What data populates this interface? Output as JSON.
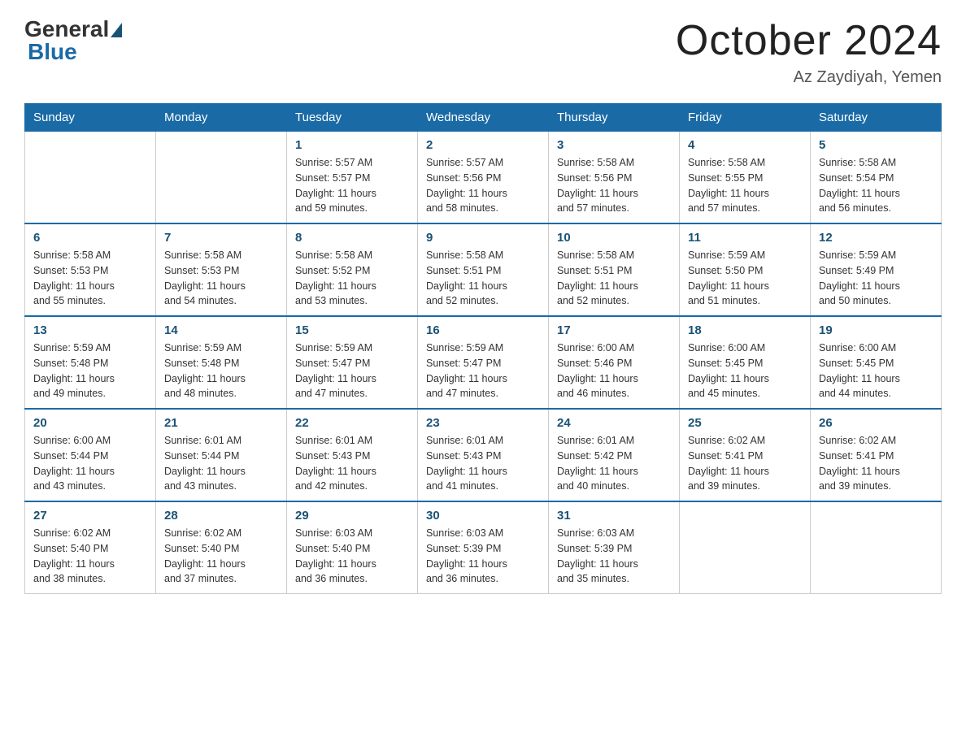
{
  "logo": {
    "general": "General",
    "blue": "Blue"
  },
  "title": "October 2024",
  "subtitle": "Az Zaydiyah, Yemen",
  "headers": [
    "Sunday",
    "Monday",
    "Tuesday",
    "Wednesday",
    "Thursday",
    "Friday",
    "Saturday"
  ],
  "weeks": [
    [
      {
        "day": "",
        "info": ""
      },
      {
        "day": "",
        "info": ""
      },
      {
        "day": "1",
        "info": "Sunrise: 5:57 AM\nSunset: 5:57 PM\nDaylight: 11 hours\nand 59 minutes."
      },
      {
        "day": "2",
        "info": "Sunrise: 5:57 AM\nSunset: 5:56 PM\nDaylight: 11 hours\nand 58 minutes."
      },
      {
        "day": "3",
        "info": "Sunrise: 5:58 AM\nSunset: 5:56 PM\nDaylight: 11 hours\nand 57 minutes."
      },
      {
        "day": "4",
        "info": "Sunrise: 5:58 AM\nSunset: 5:55 PM\nDaylight: 11 hours\nand 57 minutes."
      },
      {
        "day": "5",
        "info": "Sunrise: 5:58 AM\nSunset: 5:54 PM\nDaylight: 11 hours\nand 56 minutes."
      }
    ],
    [
      {
        "day": "6",
        "info": "Sunrise: 5:58 AM\nSunset: 5:53 PM\nDaylight: 11 hours\nand 55 minutes."
      },
      {
        "day": "7",
        "info": "Sunrise: 5:58 AM\nSunset: 5:53 PM\nDaylight: 11 hours\nand 54 minutes."
      },
      {
        "day": "8",
        "info": "Sunrise: 5:58 AM\nSunset: 5:52 PM\nDaylight: 11 hours\nand 53 minutes."
      },
      {
        "day": "9",
        "info": "Sunrise: 5:58 AM\nSunset: 5:51 PM\nDaylight: 11 hours\nand 52 minutes."
      },
      {
        "day": "10",
        "info": "Sunrise: 5:58 AM\nSunset: 5:51 PM\nDaylight: 11 hours\nand 52 minutes."
      },
      {
        "day": "11",
        "info": "Sunrise: 5:59 AM\nSunset: 5:50 PM\nDaylight: 11 hours\nand 51 minutes."
      },
      {
        "day": "12",
        "info": "Sunrise: 5:59 AM\nSunset: 5:49 PM\nDaylight: 11 hours\nand 50 minutes."
      }
    ],
    [
      {
        "day": "13",
        "info": "Sunrise: 5:59 AM\nSunset: 5:48 PM\nDaylight: 11 hours\nand 49 minutes."
      },
      {
        "day": "14",
        "info": "Sunrise: 5:59 AM\nSunset: 5:48 PM\nDaylight: 11 hours\nand 48 minutes."
      },
      {
        "day": "15",
        "info": "Sunrise: 5:59 AM\nSunset: 5:47 PM\nDaylight: 11 hours\nand 47 minutes."
      },
      {
        "day": "16",
        "info": "Sunrise: 5:59 AM\nSunset: 5:47 PM\nDaylight: 11 hours\nand 47 minutes."
      },
      {
        "day": "17",
        "info": "Sunrise: 6:00 AM\nSunset: 5:46 PM\nDaylight: 11 hours\nand 46 minutes."
      },
      {
        "day": "18",
        "info": "Sunrise: 6:00 AM\nSunset: 5:45 PM\nDaylight: 11 hours\nand 45 minutes."
      },
      {
        "day": "19",
        "info": "Sunrise: 6:00 AM\nSunset: 5:45 PM\nDaylight: 11 hours\nand 44 minutes."
      }
    ],
    [
      {
        "day": "20",
        "info": "Sunrise: 6:00 AM\nSunset: 5:44 PM\nDaylight: 11 hours\nand 43 minutes."
      },
      {
        "day": "21",
        "info": "Sunrise: 6:01 AM\nSunset: 5:44 PM\nDaylight: 11 hours\nand 43 minutes."
      },
      {
        "day": "22",
        "info": "Sunrise: 6:01 AM\nSunset: 5:43 PM\nDaylight: 11 hours\nand 42 minutes."
      },
      {
        "day": "23",
        "info": "Sunrise: 6:01 AM\nSunset: 5:43 PM\nDaylight: 11 hours\nand 41 minutes."
      },
      {
        "day": "24",
        "info": "Sunrise: 6:01 AM\nSunset: 5:42 PM\nDaylight: 11 hours\nand 40 minutes."
      },
      {
        "day": "25",
        "info": "Sunrise: 6:02 AM\nSunset: 5:41 PM\nDaylight: 11 hours\nand 39 minutes."
      },
      {
        "day": "26",
        "info": "Sunrise: 6:02 AM\nSunset: 5:41 PM\nDaylight: 11 hours\nand 39 minutes."
      }
    ],
    [
      {
        "day": "27",
        "info": "Sunrise: 6:02 AM\nSunset: 5:40 PM\nDaylight: 11 hours\nand 38 minutes."
      },
      {
        "day": "28",
        "info": "Sunrise: 6:02 AM\nSunset: 5:40 PM\nDaylight: 11 hours\nand 37 minutes."
      },
      {
        "day": "29",
        "info": "Sunrise: 6:03 AM\nSunset: 5:40 PM\nDaylight: 11 hours\nand 36 minutes."
      },
      {
        "day": "30",
        "info": "Sunrise: 6:03 AM\nSunset: 5:39 PM\nDaylight: 11 hours\nand 36 minutes."
      },
      {
        "day": "31",
        "info": "Sunrise: 6:03 AM\nSunset: 5:39 PM\nDaylight: 11 hours\nand 35 minutes."
      },
      {
        "day": "",
        "info": ""
      },
      {
        "day": "",
        "info": ""
      }
    ]
  ]
}
